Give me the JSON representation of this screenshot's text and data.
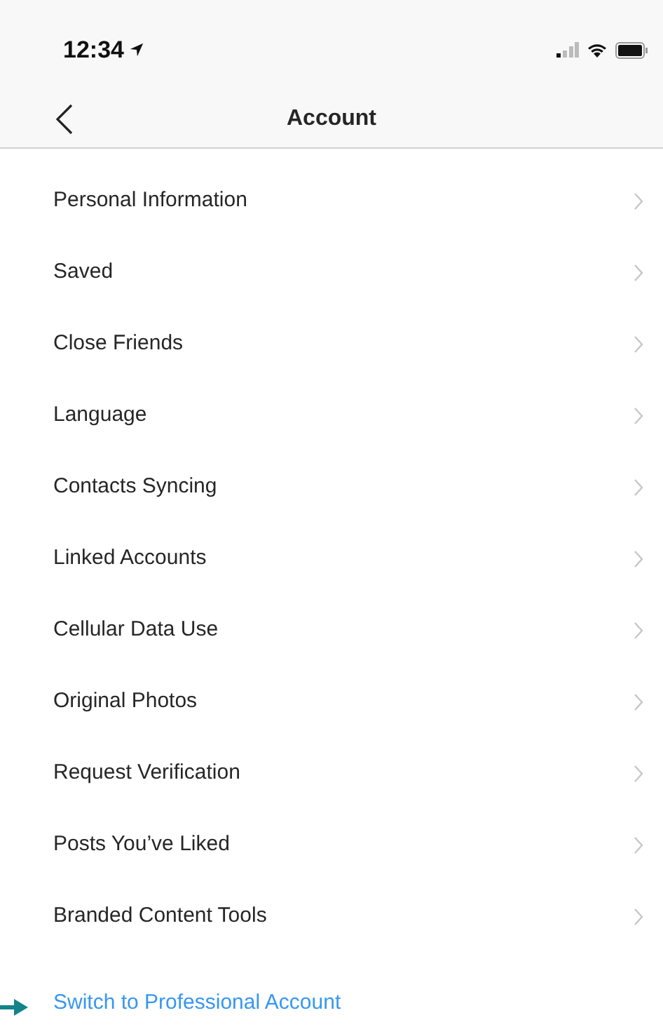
{
  "status_bar": {
    "time": "12:34"
  },
  "header": {
    "title": "Account"
  },
  "items": [
    {
      "label": "Personal Information",
      "kind": "nav"
    },
    {
      "label": "Saved",
      "kind": "nav"
    },
    {
      "label": "Close Friends",
      "kind": "nav"
    },
    {
      "label": "Language",
      "kind": "nav"
    },
    {
      "label": "Contacts Syncing",
      "kind": "nav"
    },
    {
      "label": "Linked Accounts",
      "kind": "nav"
    },
    {
      "label": "Cellular Data Use",
      "kind": "nav"
    },
    {
      "label": "Original Photos",
      "kind": "nav"
    },
    {
      "label": "Request Verification",
      "kind": "nav"
    },
    {
      "label": "Posts You’ve Liked",
      "kind": "nav"
    },
    {
      "label": "Branded Content Tools",
      "kind": "nav"
    },
    {
      "label": "Switch to Professional Account",
      "kind": "link"
    }
  ]
}
